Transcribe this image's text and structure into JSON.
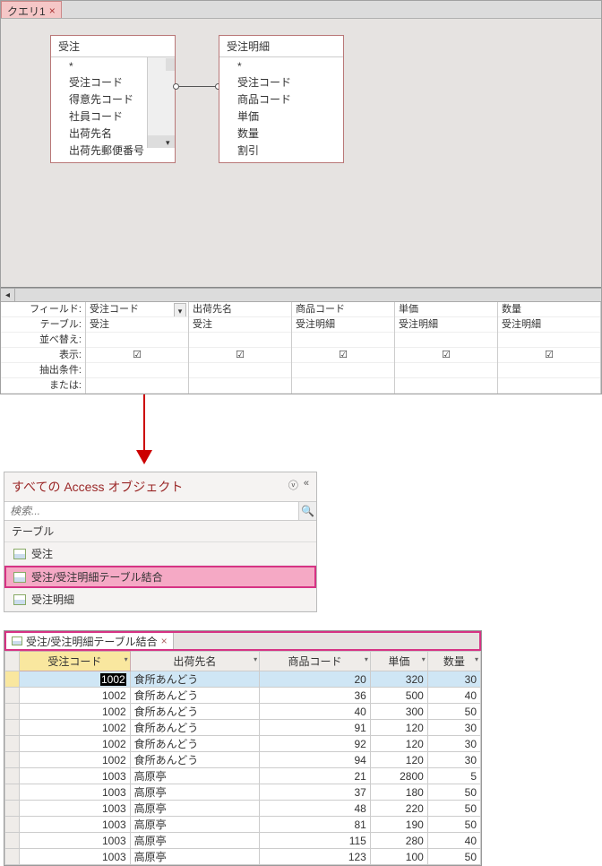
{
  "query_tab": {
    "label": "クエリ1"
  },
  "tables": {
    "left": {
      "title": "受注",
      "fields": [
        "*",
        "受注コード",
        "得意先コード",
        "社員コード",
        "出荷先名",
        "出荷先郵便番号"
      ]
    },
    "right": {
      "title": "受注明細",
      "fields": [
        "*",
        "受注コード",
        "商品コード",
        "単価",
        "数量",
        "割引"
      ]
    }
  },
  "grid_labels": [
    "フィールド:",
    "テーブル:",
    "並べ替え:",
    "表示:",
    "抽出条件:",
    "または:"
  ],
  "grid_cols": [
    {
      "field": "受注コード",
      "table": "受注",
      "show": true,
      "dd": true
    },
    {
      "field": "出荷先名",
      "table": "受注",
      "show": true
    },
    {
      "field": "商品コード",
      "table": "受注明細",
      "show": true
    },
    {
      "field": "単価",
      "table": "受注明細",
      "show": true
    },
    {
      "field": "数量",
      "table": "受注明細",
      "show": true
    }
  ],
  "nav": {
    "title": "すべての Access オブジェクト",
    "search_placeholder": "検索...",
    "section": "テーブル",
    "items": [
      {
        "label": "受注",
        "sel": false
      },
      {
        "label": "受注/受注明細テーブル結合",
        "sel": true
      },
      {
        "label": "受注明細",
        "sel": false
      }
    ]
  },
  "datasheet": {
    "tab": "受注/受注明細テーブル結合",
    "headers": [
      "受注コード",
      "出荷先名",
      "商品コード",
      "単価",
      "数量"
    ],
    "rows": [
      [
        "1002",
        "食所あんどう",
        "20",
        "320",
        "30"
      ],
      [
        "1002",
        "食所あんどう",
        "36",
        "500",
        "40"
      ],
      [
        "1002",
        "食所あんどう",
        "40",
        "300",
        "50"
      ],
      [
        "1002",
        "食所あんどう",
        "91",
        "120",
        "30"
      ],
      [
        "1002",
        "食所あんどう",
        "92",
        "120",
        "30"
      ],
      [
        "1002",
        "食所あんどう",
        "94",
        "120",
        "30"
      ],
      [
        "1003",
        "高原亭",
        "21",
        "2800",
        "5"
      ],
      [
        "1003",
        "高原亭",
        "37",
        "180",
        "50"
      ],
      [
        "1003",
        "高原亭",
        "48",
        "220",
        "50"
      ],
      [
        "1003",
        "高原亭",
        "81",
        "190",
        "50"
      ],
      [
        "1003",
        "高原亭",
        "115",
        "280",
        "40"
      ],
      [
        "1003",
        "高原亭",
        "123",
        "100",
        "50"
      ]
    ]
  }
}
